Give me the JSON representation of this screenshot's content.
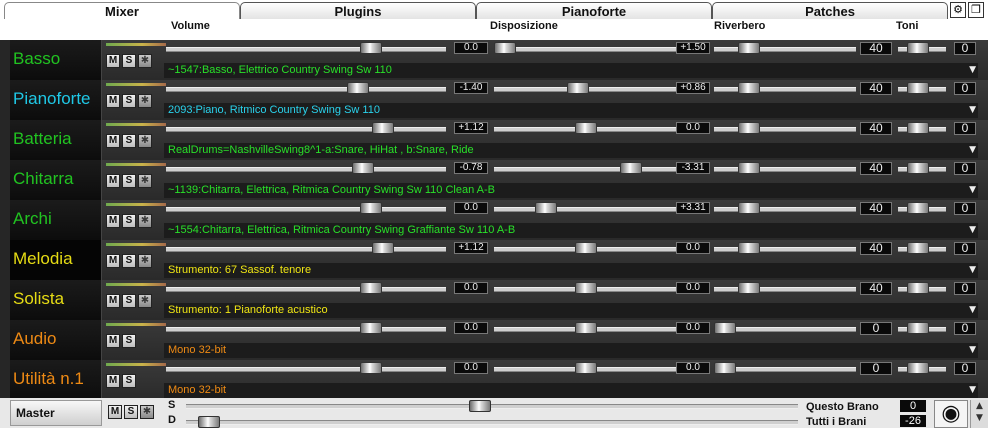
{
  "tabs": [
    {
      "label": "Mixer"
    },
    {
      "label": "Plugins"
    },
    {
      "label": "Pianoforte"
    },
    {
      "label": "Patches"
    }
  ],
  "toolbar": {
    "gear_icon": "gear-icon",
    "restore_icon": "restore-window-icon"
  },
  "columns": {
    "volume": "Volume",
    "pan": "Disposizione",
    "reverb": "Riverbero",
    "tone": "Toni"
  },
  "buttons": {
    "mute": "M",
    "solo": "S"
  },
  "channels": [
    {
      "name": "Basso",
      "name_color": "#21c321",
      "vol": "0.0",
      "vol_frac": 0.75,
      "pan": "+1.50",
      "pan_frac": 0.0,
      "reverb": "40",
      "reverb_frac": 0.2,
      "tone": "0",
      "instrument": "~1547:Basso, Elettrico Country Swing Sw 110",
      "instr_color": "#29e029",
      "has_fx": true
    },
    {
      "name": "Pianoforte",
      "name_color": "#1fc8e6",
      "vol": "-1.40",
      "vol_frac": 0.7,
      "pan": "+0.86",
      "pan_frac": 0.45,
      "reverb": "40",
      "reverb_frac": 0.2,
      "tone": "0",
      "instrument": "2093:Piano, Ritmico Country Swing Sw 110",
      "instr_color": "#2ad2ec",
      "has_fx": true
    },
    {
      "name": "Batteria",
      "name_color": "#21c321",
      "vol": "+1.12",
      "vol_frac": 0.8,
      "pan": "0.0",
      "pan_frac": 0.5,
      "reverb": "40",
      "reverb_frac": 0.2,
      "tone": "0",
      "instrument": "RealDrums=NashvilleSwing8^1-a:Snare, HiHat , b:Snare, Ride",
      "instr_color": "#29e029",
      "has_fx": true
    },
    {
      "name": "Chitarra",
      "name_color": "#21c321",
      "vol": "-0.78",
      "vol_frac": 0.72,
      "pan": "-3.31",
      "pan_frac": 0.78,
      "reverb": "40",
      "reverb_frac": 0.2,
      "tone": "0",
      "instrument": "~1139:Chitarra, Elettrica, Ritmica Country Swing Sw 110 Clean A-B",
      "instr_color": "#29e029",
      "has_fx": true
    },
    {
      "name": "Archi",
      "name_color": "#21c321",
      "vol": "0.0",
      "vol_frac": 0.75,
      "pan": "+3.31",
      "pan_frac": 0.25,
      "reverb": "40",
      "reverb_frac": 0.2,
      "tone": "0",
      "instrument": "~1554:Chitarra, Elettrica, Ritmica Country Swing Graffiante Sw 110 A-B",
      "instr_color": "#29e029",
      "has_fx": true
    },
    {
      "name": "Melodia",
      "name_color": "#e6dc14",
      "vol": "+1.12",
      "vol_frac": 0.8,
      "pan": "0.0",
      "pan_frac": 0.5,
      "reverb": "40",
      "reverb_frac": 0.2,
      "tone": "0",
      "instrument": "Strumento: 67 Sassof. tenore",
      "instr_color": "#f0e614",
      "has_fx": true,
      "selected": true
    },
    {
      "name": "Solista",
      "name_color": "#e6dc14",
      "vol": "0.0",
      "vol_frac": 0.75,
      "pan": "0.0",
      "pan_frac": 0.5,
      "reverb": "40",
      "reverb_frac": 0.2,
      "tone": "0",
      "instrument": "Strumento: 1 Pianoforte acustico",
      "instr_color": "#f0e614",
      "has_fx": true
    },
    {
      "name": "Audio",
      "name_color": "#ee8a14",
      "vol": "0.0",
      "vol_frac": 0.75,
      "pan": "0.0",
      "pan_frac": 0.5,
      "reverb": "0",
      "reverb_frac": 0.0,
      "tone": "0",
      "instrument": "Mono 32-bit",
      "instr_color": "#ee8a14",
      "has_fx": false
    },
    {
      "name": "Utilità n.1",
      "name_color": "#ee8a14",
      "vol": "0.0",
      "vol_frac": 0.75,
      "pan": "0.0",
      "pan_frac": 0.5,
      "reverb": "0",
      "reverb_frac": 0.0,
      "tone": "0",
      "instrument": "Mono 32-bit",
      "instr_color": "#ee8a14",
      "has_fx": false
    }
  ],
  "master": {
    "label": "Master",
    "s_label": "S",
    "d_label": "D",
    "s_frac": 0.48,
    "d_frac": 0.02,
    "this_song_label": "Questo Brano",
    "this_song_value": "0",
    "all_songs_label": "Tutti i Brani",
    "all_songs_value": "-26",
    "eye_icon": "eye-icon"
  },
  "colors": {
    "accent_green": "#21c321",
    "accent_cyan": "#1fc8e6",
    "accent_yellow": "#e6dc14",
    "accent_orange": "#ee8a14"
  }
}
